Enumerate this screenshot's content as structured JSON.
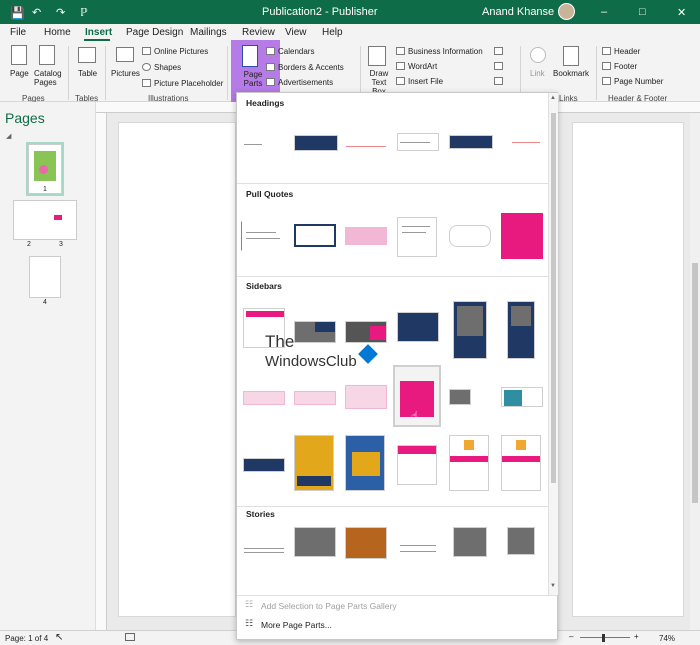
{
  "titlebar": {
    "doc_title": "Publication2 - Publisher",
    "user": "Anand Khanse",
    "accent": "#0f6c48"
  },
  "menu": {
    "tabs": [
      "File",
      "Home",
      "Insert",
      "Page Design",
      "Mailings",
      "Review",
      "View",
      "Help"
    ],
    "active": "Insert"
  },
  "ribbon": {
    "pages_group": {
      "label": "Pages",
      "page": "Page",
      "catalog_pages": "Catalog Pages"
    },
    "tables_group": {
      "label": "Tables",
      "table": "Table"
    },
    "illustrations_group": {
      "label": "Illustrations",
      "pictures": "Pictures",
      "online_pictures": "Online Pictures",
      "shapes": "Shapes",
      "picture_placeholder": "Picture Placeholder"
    },
    "building_blocks": {
      "page_parts": "Page Parts",
      "calendars": "Calendars",
      "borders_accents": "Borders & Accents",
      "advertisements": "Advertisements"
    },
    "text_group": {
      "draw_text_box": "Draw Text Box",
      "business_information": "Business Information",
      "wordart": "WordArt",
      "insert_file": "Insert File"
    },
    "links_group": {
      "label": "Links",
      "link": "Link",
      "bookmark": "Bookmark"
    },
    "header_footer_group": {
      "label": "Header & Footer",
      "header": "Header",
      "footer": "Footer",
      "page_number": "Page Number"
    }
  },
  "pages_panel": {
    "title": "Pages",
    "thumbs": [
      "1",
      "2",
      "3",
      "4"
    ]
  },
  "gallery": {
    "sections": [
      "Headings",
      "Pull Quotes",
      "Sidebars",
      "Stories"
    ],
    "footer_items": [
      "Add Selection to Page Parts Gallery",
      "More Page Parts..."
    ],
    "watermark_line1": "The",
    "watermark_line2": "WindowsClub"
  },
  "status": {
    "page": "Page: 1 of 4",
    "zoom": "74%"
  }
}
